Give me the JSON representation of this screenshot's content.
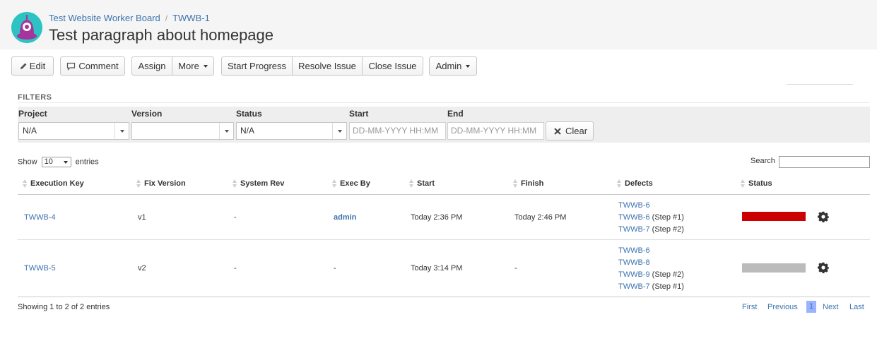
{
  "breadcrumb": {
    "project": "Test Website Worker Board",
    "separator": "/",
    "issue_key": "TWWB-1"
  },
  "issue": {
    "title": "Test paragraph about homepage"
  },
  "toolbar": {
    "edit": "Edit",
    "comment": "Comment",
    "assign": "Assign",
    "more": "More",
    "start_progress": "Start Progress",
    "resolve_issue": "Resolve Issue",
    "close_issue": "Close Issue",
    "admin": "Admin"
  },
  "filters": {
    "heading": "FILTERS",
    "project_label": "Project",
    "project_value": "N/A",
    "version_label": "Version",
    "version_value": "",
    "status_label": "Status",
    "status_value": "N/A",
    "start_label": "Start",
    "start_placeholder": "DD-MM-YYYY HH:MM",
    "end_label": "End",
    "end_placeholder": "DD-MM-YYYY HH:MM",
    "clear_label": "Clear"
  },
  "table_controls": {
    "show": "Show",
    "page_length": "10",
    "entries": "entries",
    "search_label": "Search"
  },
  "columns": [
    "Execution Key",
    "Fix Version",
    "System Rev",
    "Exec By",
    "Start",
    "Finish",
    "Defects",
    "Status"
  ],
  "rows": [
    {
      "key": "TWWB-4",
      "fix_version": "v1",
      "system_rev": "-",
      "exec_by": "admin",
      "start": "Today 2:36 PM",
      "finish": "Today 2:46 PM",
      "defects": [
        {
          "key": "TWWB-6",
          "step": ""
        },
        {
          "key": "TWWB-6",
          "step": "(Step #1)"
        },
        {
          "key": "TWWB-7",
          "step": "(Step #2)"
        }
      ],
      "status_color": "#cc0000"
    },
    {
      "key": "TWWB-5",
      "fix_version": "v2",
      "system_rev": "-",
      "exec_by": "-",
      "start": "Today 3:14 PM",
      "finish": "-",
      "defects": [
        {
          "key": "TWWB-6",
          "step": ""
        },
        {
          "key": "TWWB-8",
          "step": ""
        },
        {
          "key": "TWWB-9",
          "step": "(Step #2)"
        },
        {
          "key": "TWWB-7",
          "step": "(Step #1)"
        }
      ],
      "status_color": "#bbbbbb"
    }
  ],
  "footer": {
    "info": "Showing 1 to 2 of 2 entries",
    "first": "First",
    "previous": "Previous",
    "current_page": "1",
    "next": "Next",
    "last": "Last"
  },
  "icons": {
    "avatar": "project-avatar-icon",
    "edit": "pencil-icon",
    "comment": "speech-bubble-icon",
    "clear": "close-icon",
    "settings": "gear-icon"
  },
  "colors": {
    "link": "#3b73af",
    "fail": "#cc0000",
    "unexecuted": "#bbbbbb",
    "active_page": "#99b3ff"
  }
}
